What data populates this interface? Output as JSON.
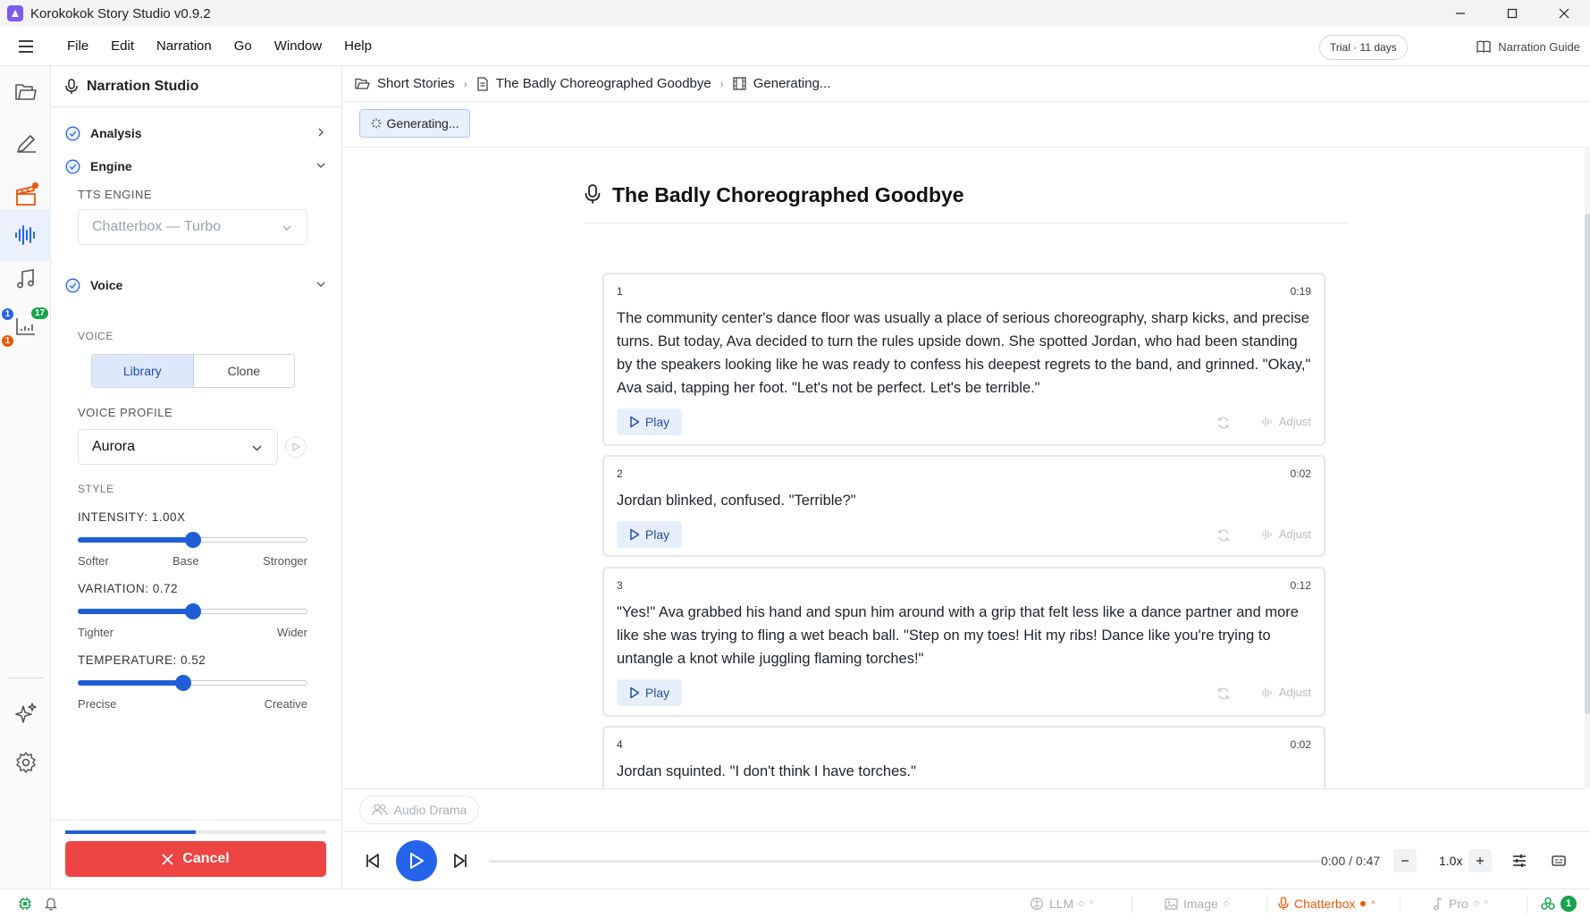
{
  "window": {
    "title": "Korokokok Story Studio v0.9.2"
  },
  "menu": {
    "items": [
      "File",
      "Edit",
      "Narration",
      "Go",
      "Window",
      "Help"
    ],
    "trial": "Trial · 11 days",
    "guide": "Narration Guide"
  },
  "rail": {
    "badges": {
      "blue": "1",
      "green": "17",
      "orange": "1"
    }
  },
  "panel": {
    "title": "Narration Studio",
    "sections": {
      "analysis": "Analysis",
      "engine": "Engine",
      "voice": "Voice"
    },
    "tts_engine_label": "TTS ENGINE",
    "tts_engine_value": "Chatterbox — Turbo",
    "voice_label": "VOICE",
    "voice_tabs": [
      "Library",
      "Clone"
    ],
    "voice_profile_label": "VOICE PROFILE",
    "voice_profile_value": "Aurora",
    "style_label": "STYLE",
    "intensity": {
      "label": "INTENSITY: 1.00X",
      "value": 0.5,
      "ends": [
        "Softer",
        "Base",
        "Stronger"
      ]
    },
    "variation": {
      "label": "VARIATION: 0.72",
      "value": 0.5,
      "ends": [
        "Tighter",
        "Wider"
      ]
    },
    "temperature": {
      "label": "TEMPERATURE: 0.52",
      "value": 0.46,
      "ends": [
        "Precise",
        "Creative"
      ]
    },
    "progress": 0.5,
    "cancel_label": "Cancel"
  },
  "breadcrumb": [
    "Short Stories",
    "The Badly Choreographed Goodbye",
    "Generating..."
  ],
  "generating_label": "Generating...",
  "document": {
    "title": "The Badly Choreographed Goodbye",
    "play_label": "Play",
    "adjust_label": "Adjust",
    "cards": [
      {
        "num": "1",
        "time": "0:19",
        "text": "The community center's dance floor was usually a place of serious choreography, sharp kicks, and precise turns. But today, Ava decided to turn the rules upside down. She spotted Jordan, who had been standing by the speakers looking like he was ready to confess his deepest regrets to the band, and grinned. \"Okay,\" Ava said, tapping her foot. \"Let's not be perfect. Let's be terrible.\""
      },
      {
        "num": "2",
        "time": "0:02",
        "text": "Jordan blinked, confused. \"Terrible?\""
      },
      {
        "num": "3",
        "time": "0:12",
        "text": "\"Yes!\" Ava grabbed his hand and spun him around with a grip that felt less like a dance partner and more like she was trying to fling a wet beach ball. \"Step on my toes! Hit my ribs! Dance like you're trying to untangle a knot while juggling flaming torches!\""
      },
      {
        "num": "4",
        "time": "0:02",
        "text": "Jordan squinted. \"I don't think I have torches.\""
      }
    ]
  },
  "audio_drama_label": "Audio Drama",
  "player": {
    "time": "0:00 / 0:47",
    "speed": "1.0x"
  },
  "status": {
    "llm": "LLM",
    "image": "Image",
    "chatterbox": "Chatterbox",
    "pro": "Pro",
    "count": "1"
  }
}
